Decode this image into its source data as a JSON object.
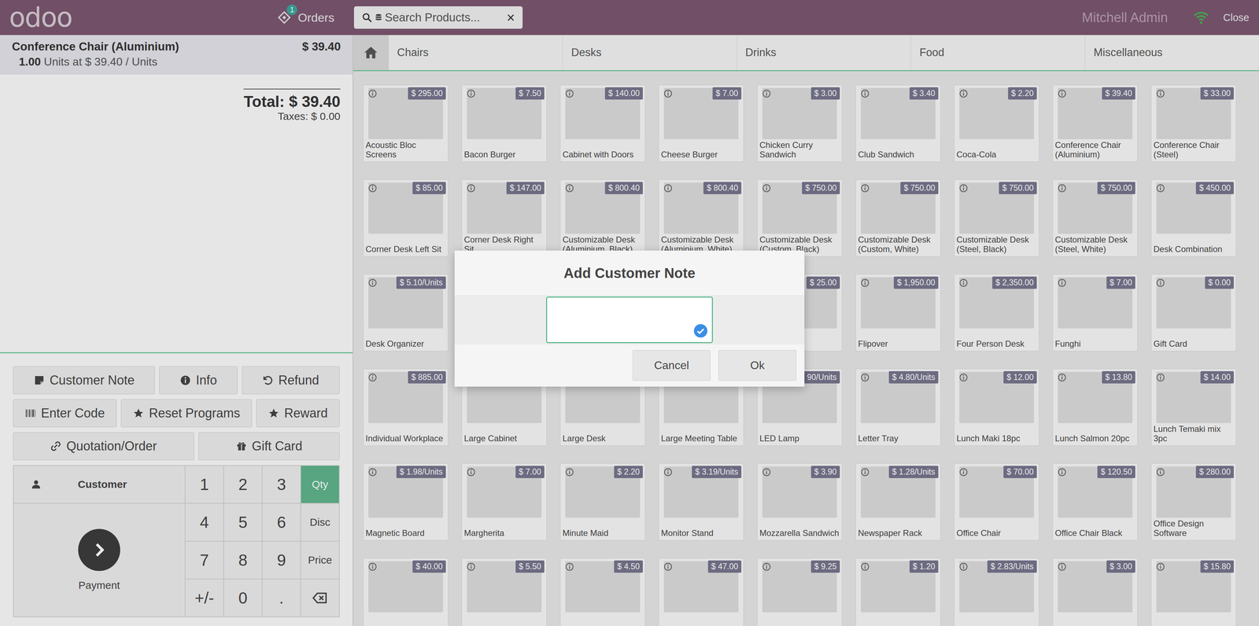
{
  "header": {
    "logo": "odoo",
    "orders_label": "Orders",
    "orders_badge": "1",
    "search_placeholder": "Search Products...",
    "search_clear": "×",
    "user": "Mitchell Admin",
    "online": true,
    "close": "Close"
  },
  "order": {
    "lines": [
      {
        "name": "Conference Chair (Aluminium)",
        "price": "$ 39.40",
        "qty": "1.00",
        "detail": "Units at $ 39.40 / Units",
        "selected": true
      }
    ],
    "total": "Total: $ 39.40",
    "taxes": "Taxes: $ 0.00"
  },
  "controls": [
    {
      "buttons": [
        {
          "label": "Customer Note",
          "kind": "note"
        },
        {
          "label": "Info",
          "kind": "info"
        },
        {
          "label": "Refund",
          "kind": "refund"
        }
      ]
    },
    {
      "buttons": [
        {
          "label": "Enter Code",
          "kind": "code"
        },
        {
          "label": "Reset Programs",
          "kind": "star"
        },
        {
          "label": "Reward",
          "kind": "star"
        }
      ]
    },
    {
      "buttons": [
        {
          "label": "Quotation/Order",
          "kind": "link"
        },
        {
          "label": "Gift Card",
          "kind": "gift"
        }
      ]
    }
  ],
  "numpad": {
    "customer": "Customer",
    "payment": "Payment",
    "keys": [
      {
        "label": "1",
        "kind": "digit",
        "selected": false
      },
      {
        "label": "2",
        "kind": "digit",
        "selected": false
      },
      {
        "label": "3",
        "kind": "digit",
        "selected": false
      },
      {
        "label": "Qty",
        "kind": "mode",
        "selected": true
      },
      {
        "label": "4",
        "kind": "digit",
        "selected": false
      },
      {
        "label": "5",
        "kind": "digit",
        "selected": false
      },
      {
        "label": "6",
        "kind": "digit",
        "selected": false
      },
      {
        "label": "Disc",
        "kind": "mode",
        "selected": false
      },
      {
        "label": "7",
        "kind": "digit",
        "selected": false
      },
      {
        "label": "8",
        "kind": "digit",
        "selected": false
      },
      {
        "label": "9",
        "kind": "digit",
        "selected": false
      },
      {
        "label": "Price",
        "kind": "mode",
        "selected": false
      },
      {
        "label": "+/-",
        "kind": "digit",
        "selected": false
      },
      {
        "label": "0",
        "kind": "digit",
        "selected": false
      },
      {
        "label": ".",
        "kind": "digit",
        "selected": false
      },
      {
        "label": "",
        "kind": "backspace",
        "selected": false
      }
    ]
  },
  "categories": [
    {
      "label": "Chairs",
      "selected": false
    },
    {
      "label": "Desks",
      "selected": false
    },
    {
      "label": "Drinks",
      "selected": false
    },
    {
      "label": "Food",
      "selected": false
    },
    {
      "label": "Miscellaneous",
      "selected": false
    }
  ],
  "products": [
    {
      "name": "Acoustic Bloc Screens",
      "price": "$ 295.00"
    },
    {
      "name": "Bacon Burger",
      "price": "$ 7.50"
    },
    {
      "name": "Cabinet with Doors",
      "price": "$ 140.00"
    },
    {
      "name": "Cheese Burger",
      "price": "$ 7.00"
    },
    {
      "name": "Chicken Curry Sandwich",
      "price": "$ 3.00"
    },
    {
      "name": "Club Sandwich",
      "price": "$ 3.40"
    },
    {
      "name": "Coca-Cola",
      "price": "$ 2.20"
    },
    {
      "name": "Conference Chair (Aluminium)",
      "price": "$ 39.40"
    },
    {
      "name": "Conference Chair (Steel)",
      "price": "$ 33.00"
    },
    {
      "name": "Corner Desk Left Sit",
      "price": "$ 85.00"
    },
    {
      "name": "Corner Desk Right Sit",
      "price": "$ 147.00"
    },
    {
      "name": "Customizable Desk (Aluminium, Black)",
      "price": "$ 800.40"
    },
    {
      "name": "Customizable Desk (Aluminium, White)",
      "price": "$ 800.40"
    },
    {
      "name": "Customizable Desk (Custom, Black)",
      "price": "$ 750.00"
    },
    {
      "name": "Customizable Desk (Custom, White)",
      "price": "$ 750.00"
    },
    {
      "name": "Customizable Desk (Steel, Black)",
      "price": "$ 750.00"
    },
    {
      "name": "Customizable Desk (Steel, White)",
      "price": "$ 750.00"
    },
    {
      "name": "Desk Combination",
      "price": "$ 450.00"
    },
    {
      "name": "Desk Organizer",
      "price": "$ 5.10/Units"
    },
    {
      "name": "",
      "price": ""
    },
    {
      "name": "",
      "price": ""
    },
    {
      "name": "",
      "price": ""
    },
    {
      "name": "",
      "price": "$ 25.00"
    },
    {
      "name": "Flipover",
      "price": "$ 1,950.00"
    },
    {
      "name": "Four Person Desk",
      "price": "$ 2,350.00"
    },
    {
      "name": "Funghi",
      "price": "$ 7.00"
    },
    {
      "name": "Gift Card",
      "price": "$ 0.00"
    },
    {
      "name": "Individual Workplace",
      "price": "$ 885.00"
    },
    {
      "name": "Large Cabinet",
      "price": ""
    },
    {
      "name": "Large Desk",
      "price": ""
    },
    {
      "name": "Large Meeting Table",
      "price": ""
    },
    {
      "name": "LED Lamp",
      "price": "90/Units"
    },
    {
      "name": "Letter Tray",
      "price": "$ 4.80/Units"
    },
    {
      "name": "Lunch Maki 18pc",
      "price": "$ 12.00"
    },
    {
      "name": "Lunch Salmon 20pc",
      "price": "$ 13.80"
    },
    {
      "name": "Lunch Temaki mix 3pc",
      "price": "$ 14.00"
    },
    {
      "name": "Magnetic Board",
      "price": "$ 1.98/Units"
    },
    {
      "name": "Margherita",
      "price": "$ 7.00"
    },
    {
      "name": "Minute Maid",
      "price": "$ 2.20"
    },
    {
      "name": "Monitor Stand",
      "price": "$ 3.19/Units"
    },
    {
      "name": "Mozzarella Sandwich",
      "price": "$ 3.90"
    },
    {
      "name": "Newspaper Rack",
      "price": "$ 1.28/Units"
    },
    {
      "name": "Office Chair",
      "price": "$ 70.00"
    },
    {
      "name": "Office Chair Black",
      "price": "$ 120.50"
    },
    {
      "name": "Office Design Software",
      "price": "$ 280.00"
    },
    {
      "name": "",
      "price": "$ 40.00"
    },
    {
      "name": "",
      "price": "$ 5.50"
    },
    {
      "name": "",
      "price": "$ 4.50"
    },
    {
      "name": "",
      "price": "$ 47.00"
    },
    {
      "name": "",
      "price": "$ 9.25"
    },
    {
      "name": "",
      "price": "$ 1.20"
    },
    {
      "name": "",
      "price": "$ 2.83/Units"
    },
    {
      "name": "",
      "price": "$ 3.00"
    },
    {
      "name": "",
      "price": "$ 15.80"
    }
  ],
  "modal": {
    "title": "Add Customer Note",
    "value": "",
    "buttons": [
      {
        "label": "Cancel"
      },
      {
        "label": "Ok"
      }
    ]
  }
}
